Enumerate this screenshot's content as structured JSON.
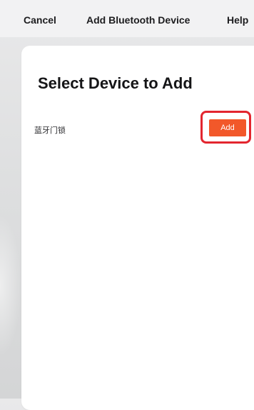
{
  "header": {
    "cancel_label": "Cancel",
    "title": "Add Bluetooth Device",
    "help_label": "Help"
  },
  "main": {
    "heading": "Select Device to Add",
    "devices": [
      {
        "name": "蓝牙门锁",
        "action_label": "Add"
      }
    ]
  },
  "colors": {
    "accent": "#f2582a",
    "highlight": "#e3262f"
  }
}
